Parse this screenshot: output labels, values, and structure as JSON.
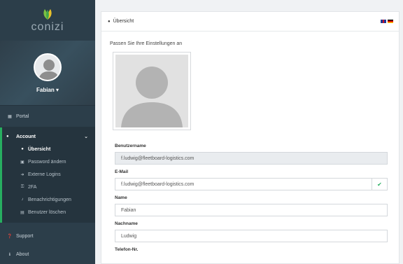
{
  "brand": {
    "logo_text": "conizi",
    "accent": "#27ae60"
  },
  "user": {
    "name": "Fabian ▾"
  },
  "sidebar": {
    "portal": {
      "label": "Portal",
      "icon": "grid-icon"
    },
    "account": {
      "label": "Account",
      "icon": "user-icon"
    },
    "sub_items": [
      {
        "label": "Übersicht",
        "icon": "user-icon",
        "active": true
      },
      {
        "label": "Password ändern",
        "icon": "lock-icon"
      },
      {
        "label": "Externe Logins",
        "icon": "sign-in-icon"
      },
      {
        "label": "2FA",
        "icon": "key-icon"
      },
      {
        "label": "Benachrichtigungen",
        "icon": "bell-icon"
      },
      {
        "label": "Benutzer löschen",
        "icon": "trash-icon"
      }
    ],
    "support": {
      "label": "Support",
      "icon": "help-icon"
    },
    "about": {
      "label": "About",
      "icon": "info-icon"
    }
  },
  "main": {
    "header_title": "Übersicht",
    "subtitle": "Passen Sie Ihre Einstellungen an",
    "fields": {
      "username_label": "Benutzername",
      "username_value": "f.ludwig@fleetboard-logistics.com",
      "email_label": "E-Mail",
      "email_value": "f.ludwig@fleetboard-logistics.com",
      "name_label": "Name",
      "name_value": "Fabian",
      "lastname_label": "Nachname",
      "lastname_value": "Ludwig",
      "phone_label": "Telefon-Nr."
    }
  }
}
